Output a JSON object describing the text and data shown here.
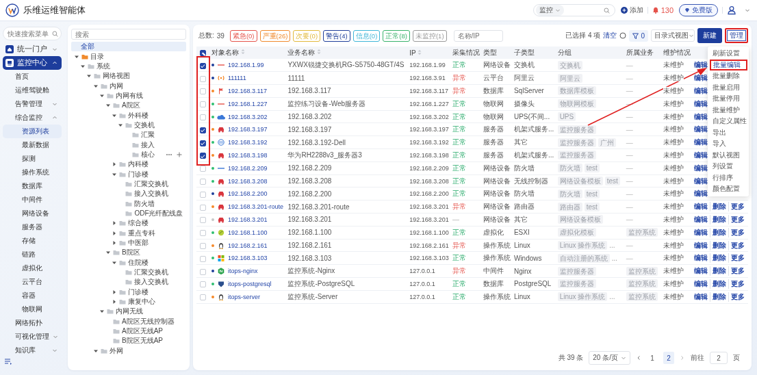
{
  "header": {
    "brand": "乐维运维智能体",
    "scope": "监控",
    "add": "添加",
    "alarm_count": "130",
    "edition": "免费版"
  },
  "sidebar": {
    "search_placeholder": "快速搜索菜单",
    "items": [
      {
        "label": "统一门户",
        "kind": "group",
        "expanded": false,
        "selected": false
      },
      {
        "label": "监控中心",
        "kind": "group",
        "expanded": true,
        "selected": true,
        "children": [
          {
            "label": "首页",
            "kind": "link",
            "selected": false
          },
          {
            "label": "运维驾驶舱",
            "kind": "link",
            "selected": false
          },
          {
            "label": "告警管理",
            "kind": "group",
            "expanded": false,
            "selected": false
          },
          {
            "label": "综合监控",
            "kind": "group",
            "expanded": true,
            "selected": false,
            "children": [
              {
                "label": "资源列表",
                "kind": "link",
                "selected": true
              },
              {
                "label": "最新数据",
                "kind": "link",
                "selected": false
              },
              {
                "label": "探测",
                "kind": "link",
                "selected": false
              },
              {
                "label": "操作系统",
                "kind": "link",
                "selected": false
              },
              {
                "label": "数据库",
                "kind": "link",
                "selected": false
              },
              {
                "label": "中间件",
                "kind": "link",
                "selected": false
              },
              {
                "label": "网络设备",
                "kind": "link",
                "selected": false
              },
              {
                "label": "服务器",
                "kind": "link",
                "selected": false
              },
              {
                "label": "存储",
                "kind": "link",
                "selected": false
              },
              {
                "label": "链路",
                "kind": "link",
                "selected": false
              },
              {
                "label": "虚拟化",
                "kind": "link",
                "selected": false
              },
              {
                "label": "云平台",
                "kind": "link",
                "selected": false
              },
              {
                "label": "容器",
                "kind": "link",
                "selected": false
              },
              {
                "label": "物联网",
                "kind": "link",
                "selected": false
              }
            ]
          },
          {
            "label": "网络拓扑",
            "kind": "link",
            "selected": false
          },
          {
            "label": "可视化管理",
            "kind": "group",
            "expanded": false,
            "selected": false
          },
          {
            "label": "知识库",
            "kind": "group",
            "expanded": false,
            "selected": false
          }
        ]
      }
    ]
  },
  "tree": {
    "search_placeholder": "搜索",
    "items": [
      {
        "label": "全部",
        "kind": "all",
        "selected": true
      },
      {
        "label": "目录",
        "kind": "root",
        "expanded": true,
        "selected": false,
        "children": [
          {
            "label": "系统",
            "kind": "branch",
            "expanded": true,
            "selected": false,
            "children": [
              {
                "label": "网络视图",
                "kind": "branch",
                "expanded": true,
                "selected": false,
                "children": [
                  {
                    "label": "内网",
                    "kind": "branch",
                    "expanded": true,
                    "selected": false,
                    "children": [
                      {
                        "label": "内网有线",
                        "kind": "branch",
                        "expanded": true,
                        "selected": false,
                        "children": [
                          {
                            "label": "A院区",
                            "kind": "branch",
                            "expanded": true,
                            "selected": false,
                            "children": [
                              {
                                "label": "外科楼",
                                "kind": "branch",
                                "expanded": true,
                                "selected": false,
                                "children": [
                                  {
                                    "label": "交换机",
                                    "kind": "branch",
                                    "expanded": true,
                                    "selected": false,
                                    "children": [
                                      {
                                        "label": "汇聚",
                                        "kind": "leaf",
                                        "selected": false
                                      },
                                      {
                                        "label": "接入",
                                        "kind": "leaf",
                                        "selected": false
                                      },
                                      {
                                        "label": "核心",
                                        "kind": "leaf",
                                        "selected": false,
                                        "hovered": true
                                      }
                                    ]
                                  }
                                ]
                              },
                              {
                                "label": "内科楼",
                                "kind": "branch",
                                "expanded": false,
                                "selected": false
                              },
                              {
                                "label": "门诊楼",
                                "kind": "branch",
                                "expanded": true,
                                "selected": false,
                                "children": [
                                  {
                                    "label": "汇聚交换机",
                                    "kind": "leaf",
                                    "selected": false
                                  },
                                  {
                                    "label": "接入交换机",
                                    "kind": "leaf",
                                    "selected": false
                                  },
                                  {
                                    "label": "防火墙",
                                    "kind": "leaf",
                                    "selected": false
                                  },
                                  {
                                    "label": "ODF光纤配线盘",
                                    "kind": "leaf",
                                    "selected": false
                                  }
                                ]
                              },
                              {
                                "label": "综合楼",
                                "kind": "branch",
                                "expanded": false,
                                "selected": false
                              },
                              {
                                "label": "重点专科",
                                "kind": "branch",
                                "expanded": false,
                                "selected": false
                              },
                              {
                                "label": "中医部",
                                "kind": "branch",
                                "expanded": false,
                                "selected": false
                              }
                            ]
                          },
                          {
                            "label": "B院区",
                            "kind": "branch",
                            "expanded": true,
                            "selected": false,
                            "children": [
                              {
                                "label": "住院楼",
                                "kind": "branch",
                                "expanded": true,
                                "selected": false,
                                "children": [
                                  {
                                    "label": "汇聚交换机",
                                    "kind": "leaf",
                                    "selected": false
                                  },
                                  {
                                    "label": "接入交换机",
                                    "kind": "leaf",
                                    "selected": false
                                  }
                                ]
                              },
                              {
                                "label": "门诊楼",
                                "kind": "branch",
                                "expanded": false,
                                "selected": false
                              },
                              {
                                "label": "康复中心",
                                "kind": "branch",
                                "expanded": false,
                                "selected": false
                              }
                            ]
                          }
                        ]
                      },
                      {
                        "label": "内网无线",
                        "kind": "branch",
                        "expanded": true,
                        "selected": false,
                        "children": [
                          {
                            "label": "A院区无线控制器",
                            "kind": "leaf",
                            "selected": false
                          },
                          {
                            "label": "A院区无线AP",
                            "kind": "leaf",
                            "selected": false
                          },
                          {
                            "label": "B院区无线AP",
                            "kind": "leaf",
                            "selected": false
                          }
                        ]
                      }
                    ]
                  },
                  {
                    "label": "外网",
                    "kind": "branch",
                    "expanded": true,
                    "selected": false
                  }
                ]
              }
            ]
          }
        ]
      }
    ]
  },
  "toolbar": {
    "total_label": "总数:",
    "total": "39",
    "chips": [
      {
        "label": "紧急(0)",
        "color": "#e5534b"
      },
      {
        "label": "严重(26)",
        "color": "#f08a2c"
      },
      {
        "label": "次要(0)",
        "color": "#e2b93b"
      },
      {
        "label": "警告(4)",
        "color": "#1f3f9a"
      },
      {
        "label": "信息(0)",
        "color": "#3fb6d8"
      },
      {
        "label": "正常(8)",
        "color": "#38b26b"
      },
      {
        "label": "未监控(1)",
        "color": "#9a9a9a"
      }
    ],
    "search_placeholder": "名称/IP",
    "selection": "已选择 4 项",
    "clear": "清空",
    "filter_count": "0",
    "view": "目录式视图",
    "new": "新建",
    "manage": {
      "label": "管理",
      "highlighted": true
    }
  },
  "table": {
    "select_all": {
      "partial": true
    },
    "columns": [
      {
        "label": "对象名称",
        "sortable": true
      },
      {
        "label": "业务名称",
        "sortable": true
      },
      {
        "label": "IP",
        "sortable": true
      },
      {
        "label": "采集情况",
        "sortable": false
      },
      {
        "label": "类型",
        "sortable": false
      },
      {
        "label": "子类型",
        "sortable": false
      },
      {
        "label": "分组",
        "sortable": false
      },
      {
        "label": "所属业务",
        "sortable": false
      },
      {
        "label": "维护情况",
        "sortable": false
      }
    ],
    "rows": [
      {
        "checked": true,
        "color": "#1f3f9a",
        "icon": {
          "kind": "line-red"
        },
        "name": "192.168.1.99",
        "business": "YXWX锐捷交换机RG-S5750-48GT/4S",
        "ip": "192.168.1.99",
        "collect": {
          "label": "正常",
          "kind": "ok"
        },
        "type": "网络设备",
        "subtype": "交换机",
        "groups": [
          "交换机"
        ],
        "affiliation": "—",
        "maintenance": "未维护",
        "actions": [
          "编辑"
        ]
      },
      {
        "checked": false,
        "color": "#1f3f9a",
        "icon": {
          "kind": "antenna"
        },
        "name": "111111",
        "business": "11111",
        "ip": "192.168.3.91",
        "collect": {
          "label": "异常",
          "kind": "error"
        },
        "type": "云平台",
        "subtype": "阿里云",
        "groups": [
          "阿里云"
        ],
        "affiliation": "—",
        "maintenance": "未维护",
        "actions": [
          "编辑"
        ]
      },
      {
        "checked": false,
        "color": "#f5892a",
        "icon": {
          "kind": "flag"
        },
        "name": "192.168.3.117",
        "business": "192.168.3.117",
        "ip": "192.168.3.117",
        "collect": {
          "label": "异常",
          "kind": "error"
        },
        "type": "数据库",
        "subtype": "SqlServer",
        "groups": [
          "数据库模板"
        ],
        "affiliation": "—",
        "maintenance": "未维护",
        "actions": [
          "编辑"
        ]
      },
      {
        "checked": false,
        "color": "#2fbf71",
        "icon": {
          "kind": "line-red"
        },
        "name": "192.168.1.227",
        "business": "监控练习设备-Web服务器",
        "ip": "192.168.1.227",
        "collect": {
          "label": "正常",
          "kind": "ok"
        },
        "type": "物联网",
        "subtype": "摄像头",
        "groups": [
          "物联网模板"
        ],
        "affiliation": "—",
        "maintenance": "未维护",
        "actions": [
          "编辑"
        ]
      },
      {
        "checked": false,
        "color": "#2fbf71",
        "icon": {
          "kind": "cloud"
        },
        "name": "192.168.3.202",
        "business": "192.168.3.202",
        "ip": "192.168.3.202",
        "collect": {
          "label": "正常",
          "kind": "ok"
        },
        "type": "物联网",
        "subtype": "UPS(不间...",
        "groups": [
          "UPS"
        ],
        "affiliation": "—",
        "maintenance": "未维护",
        "actions": [
          "编辑"
        ]
      },
      {
        "checked": true,
        "color": "#f5892a",
        "icon": {
          "kind": "car"
        },
        "name": "192.168.3.197",
        "business": "192.168.3.197",
        "ip": "192.168.3.197",
        "collect": {
          "label": "正常",
          "kind": "ok"
        },
        "type": "服务器",
        "subtype": "机架式服务...",
        "groups": [
          "监控服务器"
        ],
        "affiliation": "—",
        "maintenance": "未维护",
        "actions": [
          "编辑"
        ]
      },
      {
        "checked": true,
        "color": "#2fbf71",
        "icon": {
          "kind": "disc"
        },
        "name": "192.168.3.192",
        "business": "192.168.3.192-Dell",
        "ip": "192.168.3.192",
        "collect": {
          "label": "正常",
          "kind": "ok"
        },
        "type": "服务器",
        "subtype": "其它",
        "groups": [
          "监控服务器",
          "广州"
        ],
        "affiliation": "—",
        "maintenance": "未维护",
        "actions": [
          "编辑"
        ]
      },
      {
        "checked": true,
        "color": "#f5892a",
        "icon": {
          "kind": "car"
        },
        "name": "192.168.3.198",
        "business": "华为RH2288v3_服务器3",
        "ip": "192.168.3.198",
        "collect": {
          "label": "正常",
          "kind": "ok"
        },
        "type": "服务器",
        "subtype": "机架式服务...",
        "groups": [
          "监控服务器"
        ],
        "affiliation": "—",
        "maintenance": "未维护",
        "actions": [
          "编辑"
        ]
      },
      {
        "checked": false,
        "color": "#2fbf71",
        "icon": {
          "kind": "line-blue"
        },
        "name": "192.168.2.209",
        "business": "192.168.2.209",
        "ip": "192.168.2.209",
        "collect": {
          "label": "正常",
          "kind": "ok"
        },
        "type": "网络设备",
        "subtype": "防火墙",
        "groups": [
          "防火墙",
          "test"
        ],
        "affiliation": "—",
        "maintenance": "未维护",
        "actions": [
          "编辑"
        ]
      },
      {
        "checked": false,
        "color": "#2fbf71",
        "icon": {
          "kind": "car"
        },
        "name": "192.168.3.208",
        "business": "192.168.3.208",
        "ip": "192.168.3.208",
        "collect": {
          "label": "正常",
          "kind": "ok"
        },
        "type": "网络设备",
        "subtype": "无线控制器",
        "groups": [
          "网络设备模板",
          "test"
        ],
        "affiliation": "—",
        "maintenance": "未维护",
        "actions": [
          "编辑"
        ]
      },
      {
        "checked": false,
        "color": "#1f3f9a",
        "icon": {
          "kind": "car"
        },
        "name": "192.168.2.200",
        "business": "192.168.2.200",
        "ip": "192.168.2.200",
        "collect": {
          "label": "正常",
          "kind": "ok"
        },
        "type": "网络设备",
        "subtype": "防火墙",
        "groups": [
          "防火墙",
          "test"
        ],
        "affiliation": "—",
        "maintenance": "未维护",
        "actions": [
          "编辑"
        ]
      },
      {
        "checked": false,
        "color": "#f5892a",
        "icon": {
          "kind": "car"
        },
        "name": "192.168.3.201-route",
        "business": "192.168.3.201-route",
        "ip": "192.168.3.201",
        "collect": {
          "label": "异常",
          "kind": "error"
        },
        "type": "网络设备",
        "subtype": "路由器",
        "groups": [
          "路由器",
          "test"
        ],
        "affiliation": "—",
        "maintenance": "未维护",
        "actions": [
          "编辑",
          "删除",
          "更多"
        ]
      },
      {
        "checked": false,
        "color": "#c8c8c8",
        "icon": {
          "kind": "car"
        },
        "name": "192.168.3.201",
        "business": "192.168.3.201",
        "ip": "192.168.3.201",
        "collect": {
          "label": "—",
          "kind": "none"
        },
        "type": "网络设备",
        "subtype": "其它",
        "groups": [
          "网络设备模板"
        ],
        "affiliation": "—",
        "maintenance": "未维护",
        "actions": [
          "编辑",
          "删除",
          "更多"
        ]
      },
      {
        "checked": false,
        "color": "#2fbf71",
        "icon": {
          "kind": "ball"
        },
        "name": "192.168.1.100",
        "business": "192.168.1.100",
        "ip": "192.168.1.100",
        "collect": {
          "label": "正常",
          "kind": "ok"
        },
        "type": "虚拟化",
        "subtype": "ESXI",
        "groups": [
          "虚拟化模板"
        ],
        "affiliation_tags": [
          "监控系统"
        ],
        "maintenance": "未维护",
        "actions": [
          "编辑",
          "删除",
          "更多"
        ]
      },
      {
        "checked": false,
        "color": "#f5892a",
        "icon": {
          "kind": "penguin"
        },
        "name": "192.168.2.161",
        "business": "192.168.2.161",
        "ip": "192.168.2.161",
        "collect": {
          "label": "异常",
          "kind": "error"
        },
        "type": "操作系统",
        "subtype": "Linux",
        "groups": [
          "Linux 操作系统"
        ],
        "groups_overflow": "...",
        "affiliation": "—",
        "maintenance": "未维护",
        "actions": [
          "编辑",
          "删除",
          "更多"
        ]
      },
      {
        "checked": false,
        "color": "#2fbf71",
        "icon": {
          "kind": "tiles"
        },
        "name": "192.168.3.103",
        "business": "192.168.3.103",
        "ip": "192.168.3.103",
        "collect": {
          "label": "正常",
          "kind": "ok"
        },
        "type": "操作系统",
        "subtype": "Windows",
        "groups": [
          "自动注册的系统"
        ],
        "groups_overflow": "...",
        "affiliation": "—",
        "maintenance": "未维护",
        "actions": [
          "编辑",
          "删除",
          "更多"
        ]
      },
      {
        "checked": false,
        "color": "#1f3f9a",
        "icon": {
          "kind": "hexagon"
        },
        "name": "itops-nginx",
        "business": "监控系统-Nginx",
        "ip": "127.0.0.1",
        "collect": {
          "label": "异常",
          "kind": "error"
        },
        "type": "中间件",
        "subtype": "Nginx",
        "groups": [
          "监控服务器"
        ],
        "affiliation_tags": [
          "监控系统"
        ],
        "maintenance": "未维护",
        "actions": [
          "编辑",
          "删除",
          "更多"
        ]
      },
      {
        "checked": false,
        "color": "#2fbf71",
        "icon": {
          "kind": "shield"
        },
        "name": "itops-postgresql",
        "business": "监控系统-PostgreSQL",
        "ip": "127.0.0.1",
        "collect": {
          "label": "正常",
          "kind": "ok"
        },
        "type": "数据库",
        "subtype": "PostgreSQL",
        "groups": [
          "监控服务器"
        ],
        "affiliation_tags": [
          "监控系统"
        ],
        "maintenance": "未维护",
        "actions": [
          "编辑",
          "删除",
          "更多"
        ]
      },
      {
        "checked": false,
        "color": "#f5892a",
        "icon": {
          "kind": "penguin"
        },
        "name": "itops-server",
        "business": "监控系统-Server",
        "ip": "127.0.0.1",
        "collect": {
          "label": "正常",
          "kind": "ok"
        },
        "type": "操作系统",
        "subtype": "Linux",
        "groups": [
          "Linux 操作系统"
        ],
        "groups_overflow": "...",
        "affiliation_tags": [
          "监控系统"
        ],
        "maintenance": "未维护",
        "actions": [
          "编辑",
          "删除",
          "更多"
        ]
      }
    ]
  },
  "menu": {
    "items": [
      {
        "label": "刷新设置",
        "highlighted": false
      },
      {
        "label": "批量编辑",
        "highlighted": true
      },
      {
        "label": "批量删除",
        "highlighted": false
      },
      {
        "label": "批量启用",
        "highlighted": false
      },
      {
        "label": "批量停用",
        "highlighted": false
      },
      {
        "label": "批量维护",
        "highlighted": false
      },
      {
        "label": "自定义属性",
        "highlighted": false
      },
      {
        "label": "导出",
        "highlighted": false
      },
      {
        "label": "导入",
        "highlighted": false
      },
      {
        "label": "默认视图",
        "highlighted": false
      },
      {
        "label": "列设置",
        "highlighted": false
      },
      {
        "label": "行排序",
        "highlighted": false
      },
      {
        "label": "颜色配置",
        "highlighted": false
      }
    ]
  },
  "pagination": {
    "total": "共 39 条",
    "page_size": "20 条/页",
    "pages": [
      {
        "label": "1",
        "selected": false
      },
      {
        "label": "2",
        "selected": true
      }
    ],
    "goto_label": "前往",
    "goto_value": "2",
    "page_suffix": "页"
  }
}
